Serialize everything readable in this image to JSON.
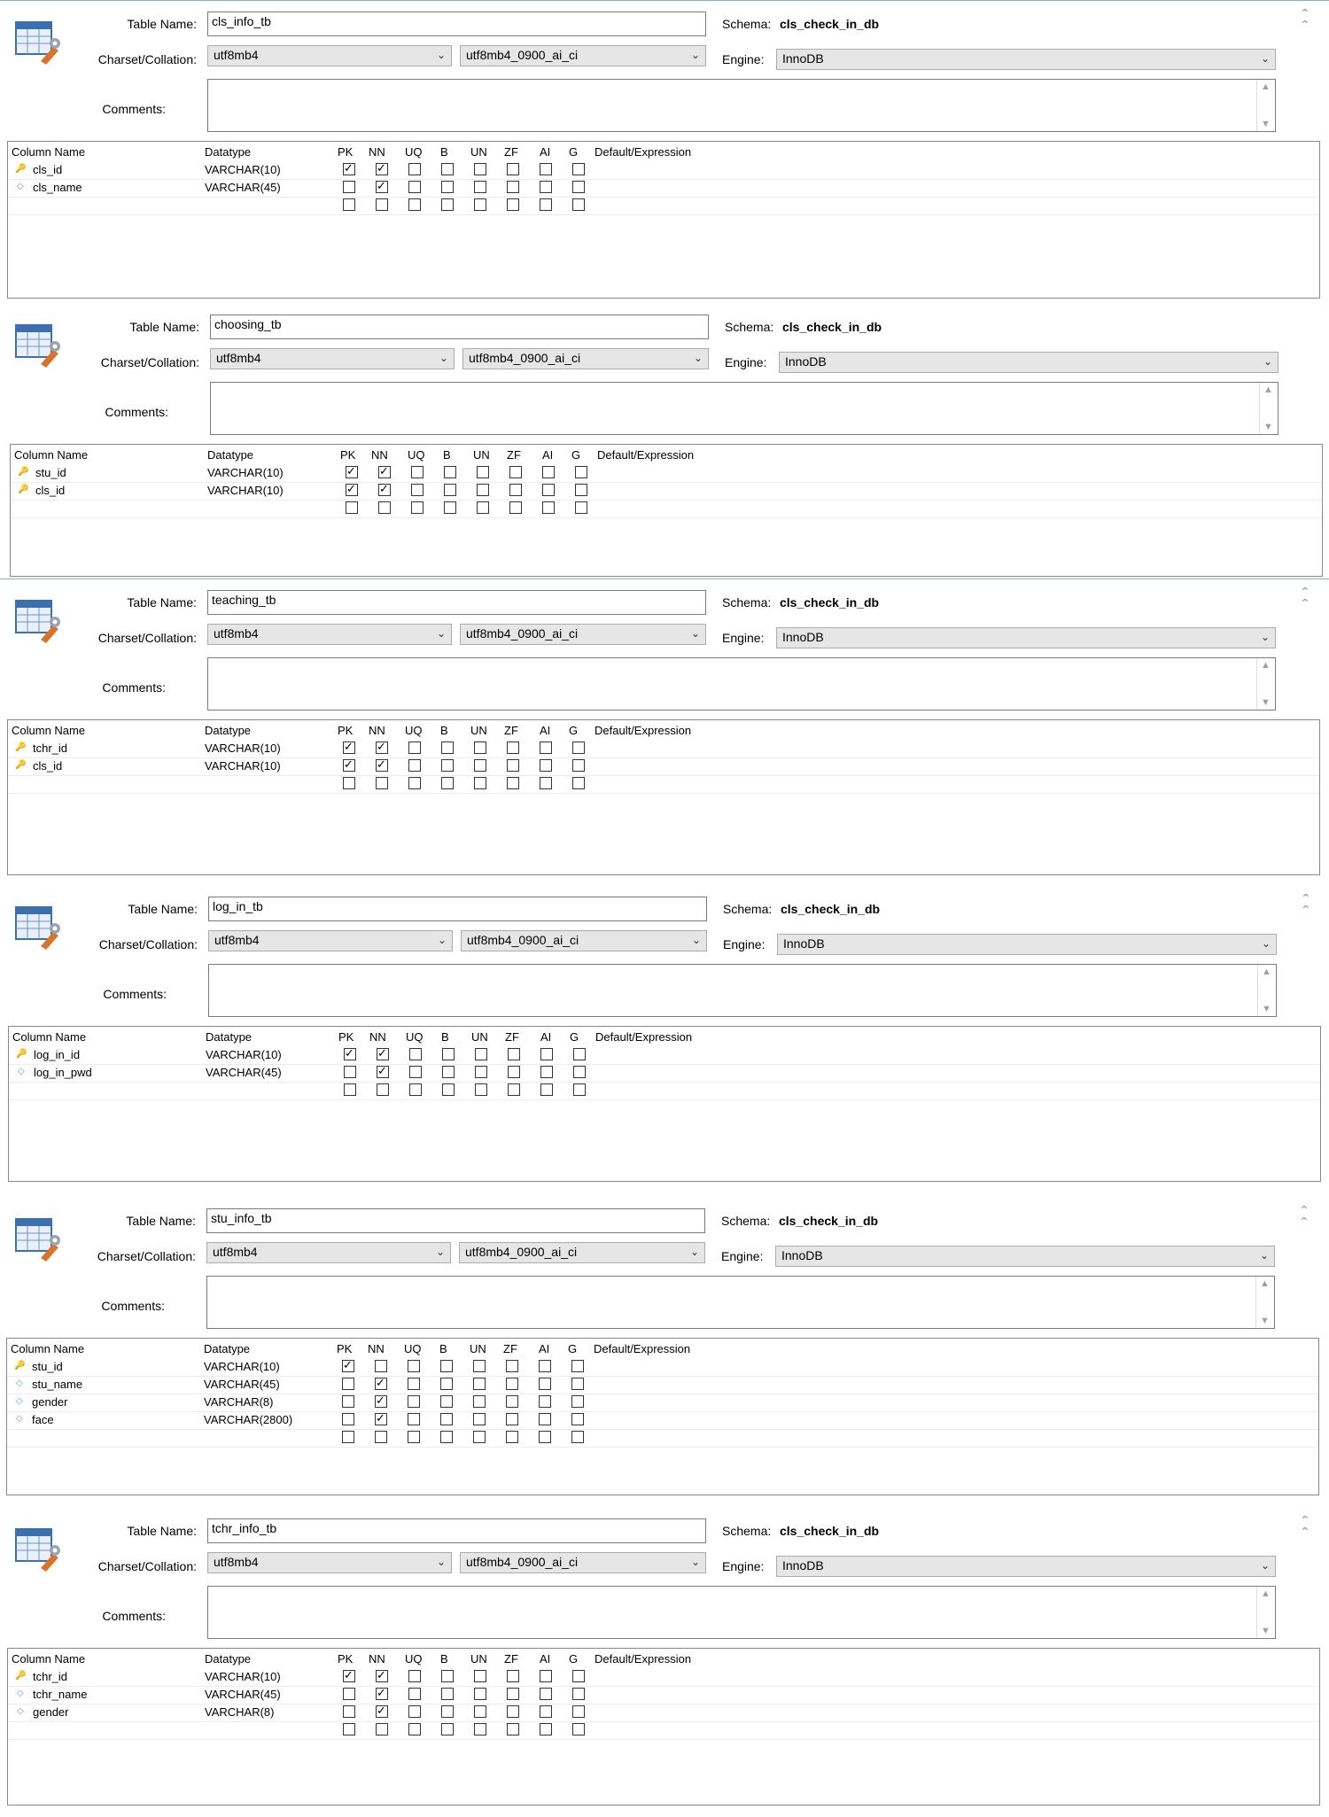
{
  "labels": {
    "table_name": "Table Name:",
    "charset": "Charset/Collation:",
    "comments": "Comments:",
    "schema": "Schema:",
    "engine": "Engine:"
  },
  "headers": [
    "Column Name",
    "Datatype",
    "PK",
    "NN",
    "UQ",
    "B",
    "UN",
    "ZF",
    "AI",
    "G",
    "Default/Expression"
  ],
  "icons": {
    "table": "table-settings-icon",
    "pk": "key-icon",
    "col": "column-diamond-icon",
    "collapse": "collapse-chevrons-icon",
    "dropdown": "chevron-down-icon"
  },
  "colors": {
    "panel_border": "#8fa9c4",
    "combo_bg": "#e6e6e6",
    "key": "#e0b000",
    "column": "#49a7c2"
  },
  "panels": [
    {
      "table_name": "cls_info_tb",
      "charset": "utf8mb4",
      "collation": "utf8mb4_0900_ai_ci",
      "schema": "cls_check_in_db",
      "engine": "InnoDB",
      "comments": "",
      "columns": [
        {
          "name": "cls_id",
          "type": "VARCHAR(10)",
          "pk": true,
          "nn": true
        },
        {
          "name": "cls_name",
          "type": "VARCHAR(45)",
          "pk": false,
          "nn": true
        }
      ]
    },
    {
      "table_name": "choosing_tb",
      "charset": "utf8mb4",
      "collation": "utf8mb4_0900_ai_ci",
      "schema": "cls_check_in_db",
      "engine": "InnoDB",
      "comments": "",
      "columns": [
        {
          "name": "stu_id",
          "type": "VARCHAR(10)",
          "pk": true,
          "nn": true
        },
        {
          "name": "cls_id",
          "type": "VARCHAR(10)",
          "pk": true,
          "nn": true
        }
      ]
    },
    {
      "table_name": "teaching_tb",
      "charset": "utf8mb4",
      "collation": "utf8mb4_0900_ai_ci",
      "schema": "cls_check_in_db",
      "engine": "InnoDB",
      "comments": "",
      "columns": [
        {
          "name": "tchr_id",
          "type": "VARCHAR(10)",
          "pk": true,
          "nn": true
        },
        {
          "name": "cls_id",
          "type": "VARCHAR(10)",
          "pk": true,
          "nn": true
        }
      ]
    },
    {
      "table_name": "log_in_tb",
      "charset": "utf8mb4",
      "collation": "utf8mb4_0900_ai_ci",
      "schema": "cls_check_in_db",
      "engine": "InnoDB",
      "comments": "",
      "columns": [
        {
          "name": "log_in_id",
          "type": "VARCHAR(10)",
          "pk": true,
          "nn": true
        },
        {
          "name": "log_in_pwd",
          "type": "VARCHAR(45)",
          "pk": false,
          "nn": true
        }
      ]
    },
    {
      "table_name": "stu_info_tb",
      "charset": "utf8mb4",
      "collation": "utf8mb4_0900_ai_ci",
      "schema": "cls_check_in_db",
      "engine": "InnoDB",
      "comments": "",
      "columns": [
        {
          "name": "stu_id",
          "type": "VARCHAR(10)",
          "pk": true,
          "nn": false
        },
        {
          "name": "stu_name",
          "type": "VARCHAR(45)",
          "pk": false,
          "nn": true
        },
        {
          "name": "gender",
          "type": "VARCHAR(8)",
          "pk": false,
          "nn": true
        },
        {
          "name": "face",
          "type": "VARCHAR(2800)",
          "pk": false,
          "nn": true
        }
      ]
    },
    {
      "table_name": "tchr_info_tb",
      "charset": "utf8mb4",
      "collation": "utf8mb4_0900_ai_ci",
      "schema": "cls_check_in_db",
      "engine": "InnoDB",
      "comments": "",
      "columns": [
        {
          "name": "tchr_id",
          "type": "VARCHAR(10)",
          "pk": true,
          "nn": true
        },
        {
          "name": "tchr_name",
          "type": "VARCHAR(45)",
          "pk": false,
          "nn": true
        },
        {
          "name": "gender",
          "type": "VARCHAR(8)",
          "pk": false,
          "nn": true
        }
      ]
    }
  ]
}
